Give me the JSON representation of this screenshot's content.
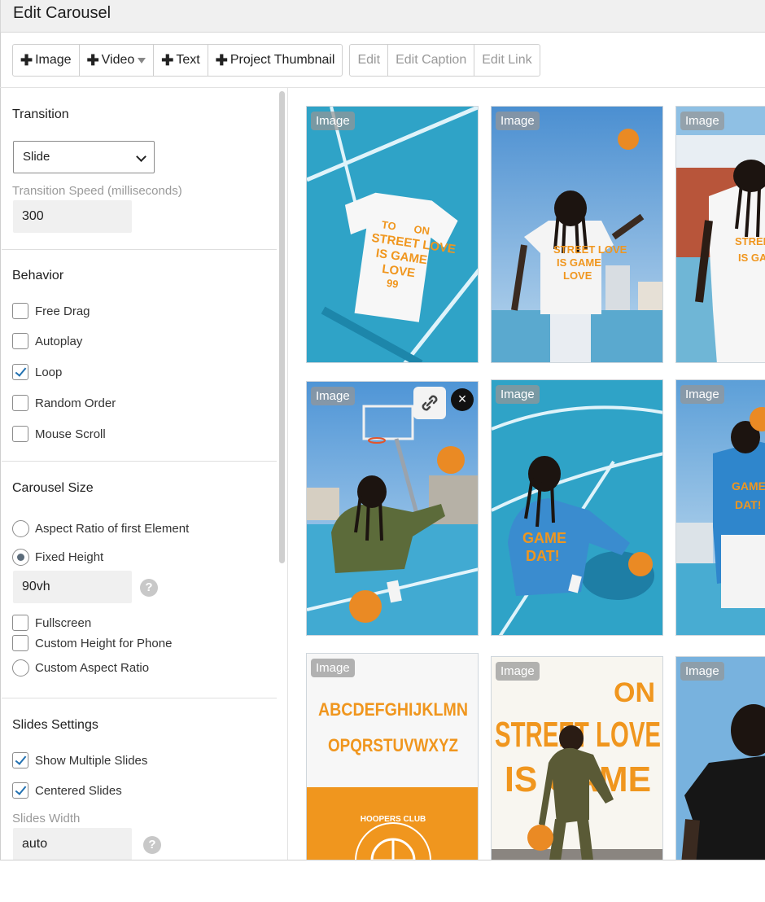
{
  "window": {
    "title": "Edit Carousel"
  },
  "toolbar": {
    "add_buttons": [
      {
        "label": "Image",
        "name": "add-image-button",
        "plus": "✚"
      },
      {
        "label": "Video",
        "name": "add-video-button",
        "plus": "✚",
        "has_caret": true
      },
      {
        "label": "Text",
        "name": "add-text-button",
        "plus": "✚"
      },
      {
        "label": "Project Thumbnail",
        "name": "add-project-thumbnail-button",
        "plus": "✚"
      }
    ],
    "edit_buttons": [
      {
        "label": "Edit",
        "name": "edit-button"
      },
      {
        "label": "Edit Caption",
        "name": "edit-caption-button"
      },
      {
        "label": "Edit Link",
        "name": "edit-link-button"
      }
    ]
  },
  "sidebar": {
    "transition": {
      "title": "Transition",
      "selected": "Slide",
      "speed_label": "Transition Speed (milliseconds)",
      "speed_value": "300"
    },
    "behavior": {
      "title": "Behavior",
      "options": [
        {
          "label": "Free Drag",
          "checked": false
        },
        {
          "label": "Autoplay",
          "checked": false
        },
        {
          "label": "Loop",
          "checked": true
        },
        {
          "label": "Random Order",
          "checked": false
        },
        {
          "label": "Mouse Scroll",
          "checked": false
        }
      ]
    },
    "carousel_size": {
      "title": "Carousel Size",
      "radio_aspect": "Aspect Ratio of first Element",
      "radio_fixed": "Fixed Height",
      "height_value": "90vh",
      "help": "?",
      "fullscreen": "Fullscreen",
      "custom_phone": "Custom Height for Phone",
      "custom_aspect": "Custom Aspect Ratio"
    },
    "slides_settings": {
      "title": "Slides Settings",
      "show_multiple": "Show Multiple Slides",
      "centered": "Centered Slides",
      "width_label": "Slides Width",
      "width_value": "auto",
      "help": "?"
    }
  },
  "grid": {
    "badge": "Image",
    "link_icon": "link-icon",
    "close_icon": "close-icon",
    "close_glyph": "×",
    "poster_letters": [
      "ABCDEFGHIJKLMN",
      "OPQRSTUVWXYZ"
    ],
    "poster_lettering": "HOOPERS CLUB",
    "shirt_lettering": [
      "TO",
      "ON",
      "STREET LOVE",
      "IS GAME",
      "LOVE",
      "99"
    ],
    "jacket_lettering": [
      "GAME",
      "DAT!"
    ],
    "street_poster_lettering": [
      "ON",
      "STREET LOVE",
      "IS GAME"
    ],
    "colors": {
      "court_blue": "#2fa3c7",
      "orange": "#f0961e",
      "sky": "#7fb6de"
    }
  }
}
